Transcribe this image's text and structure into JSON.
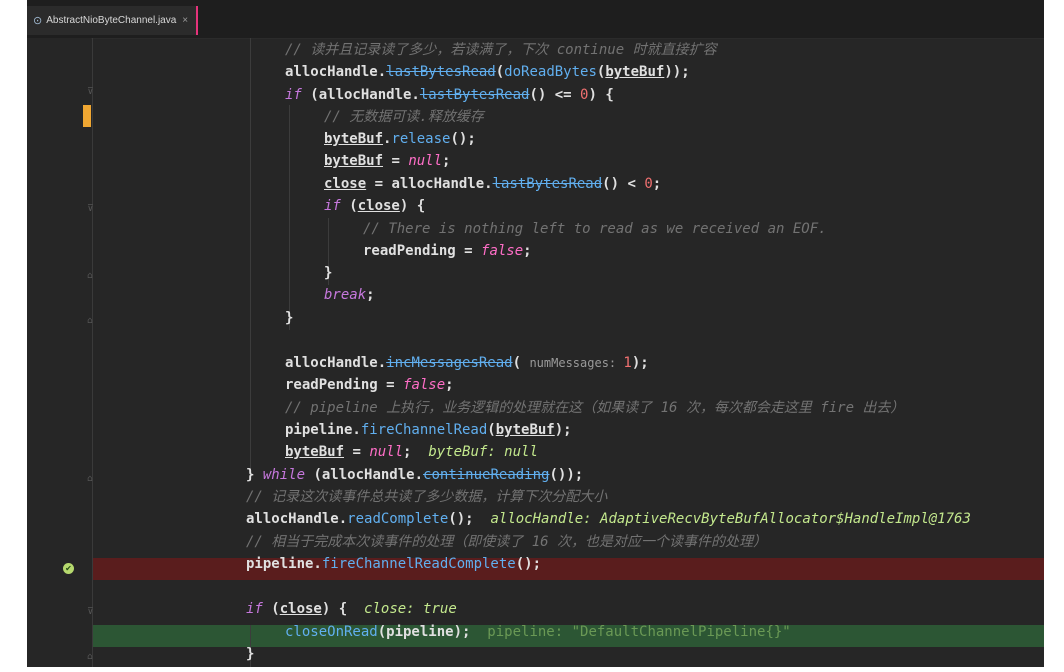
{
  "tab": {
    "title": "AbstractNioByteChannel.java",
    "close": "×"
  },
  "lines": [
    [
      "c",
      "// 读并且记录读了多少，若读满了，下次 continue 时就直接扩容"
    ],
    [
      "allocHandle.",
      "mw:lastBytesRead",
      "(",
      "m:doReadBytes",
      "(",
      "u:byteBuf",
      "));"
    ],
    [
      "k:if",
      " (allocHandle.",
      "mw:lastBytesRead",
      "() <= ",
      "n:0",
      ") {"
    ],
    [
      "c",
      "// 无数据可读.释放缓存"
    ],
    [
      "u:byteBuf",
      ".",
      "m:release",
      "();"
    ],
    [
      "u:byteBuf",
      " = ",
      "kw:null",
      ";"
    ],
    [
      "u:close",
      " = allocHandle.",
      "mw:lastBytesRead",
      "() < ",
      "n:0",
      ";"
    ],
    [
      "k:if",
      " (",
      "u:close",
      ") {"
    ],
    [
      "c",
      "// There is nothing left to read as we received an EOF."
    ],
    [
      "readPending = ",
      "kw:false",
      ";"
    ],
    [
      "}"
    ],
    [
      "k:break",
      ";"
    ],
    [
      "}"
    ],
    [],
    [
      "allocHandle.",
      "mw:incMessagesRead",
      "( ",
      "hint:numMessages: ",
      "n:1",
      ");"
    ],
    [
      "readPending = ",
      "kw:false",
      ";"
    ],
    [
      "c",
      "// pipeline 上执行，业务逻辑的处理就在这（如果读了 16 次，每次都会走这里 fire 出去）"
    ],
    [
      "pipeline.",
      "m:fireChannelRead",
      "(",
      "u:byteBuf",
      ");"
    ],
    [
      "u:byteBuf",
      " = ",
      "kw:null",
      ";  ",
      "dbg:byteBuf: null"
    ],
    [
      "} ",
      "k:while",
      " (allocHandle.",
      "mw:continueReading",
      "());"
    ],
    [
      "c",
      "// 记录这次读事件总共读了多少数据，计算下次分配大小"
    ],
    [
      "allocHandle.",
      "m:readComplete",
      "();  ",
      "dbg:allocHandle: AdaptiveRecvByteBufAllocator$HandleImpl@1763"
    ],
    [
      "c",
      "// 相当于完成本次读事件的处理（即使读了 16 次，也是对应一个读事件的处理）"
    ],
    [
      "pipeline.",
      "m:fireChannelReadComplete",
      "();"
    ],
    [],
    [
      "k:if",
      " (",
      "u:close",
      ") {  ",
      "dbg:close: true"
    ],
    [
      "m:closeOnRead",
      "(pipeline);  ",
      "dbgw:pipeline: \"DefaultChannelPipeline{}\""
    ],
    [
      "}"
    ]
  ],
  "debugger": {
    "breakpoint_icon": "✔"
  }
}
